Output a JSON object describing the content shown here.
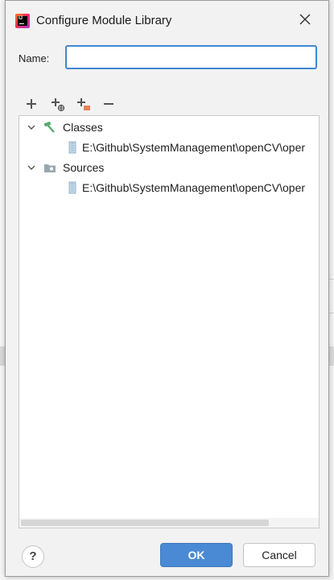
{
  "window": {
    "title": "Configure Module Library"
  },
  "form": {
    "name_label": "Name:",
    "name_value": "",
    "name_placeholder": ""
  },
  "toolbar": {
    "icons": [
      "add-icon",
      "add-web-icon",
      "add-folder-icon",
      "remove-icon"
    ]
  },
  "tree": {
    "nodes": [
      {
        "label": "Classes",
        "icon": "hammer-icon",
        "expanded": true,
        "children": [
          {
            "label": "E:\\Github\\SystemManagement\\openCV\\oper",
            "icon": "jar-icon"
          }
        ]
      },
      {
        "label": "Sources",
        "icon": "folder-icon",
        "expanded": true,
        "children": [
          {
            "label": "E:\\Github\\SystemManagement\\openCV\\oper",
            "icon": "jar-icon"
          }
        ]
      }
    ]
  },
  "buttons": {
    "help": "?",
    "ok": "OK",
    "cancel": "Cancel"
  },
  "colors": {
    "accent": "#3e88d4",
    "ok_button": "#4a8ad4",
    "hammer": "#59a869",
    "folder": "#9aa7b0"
  }
}
